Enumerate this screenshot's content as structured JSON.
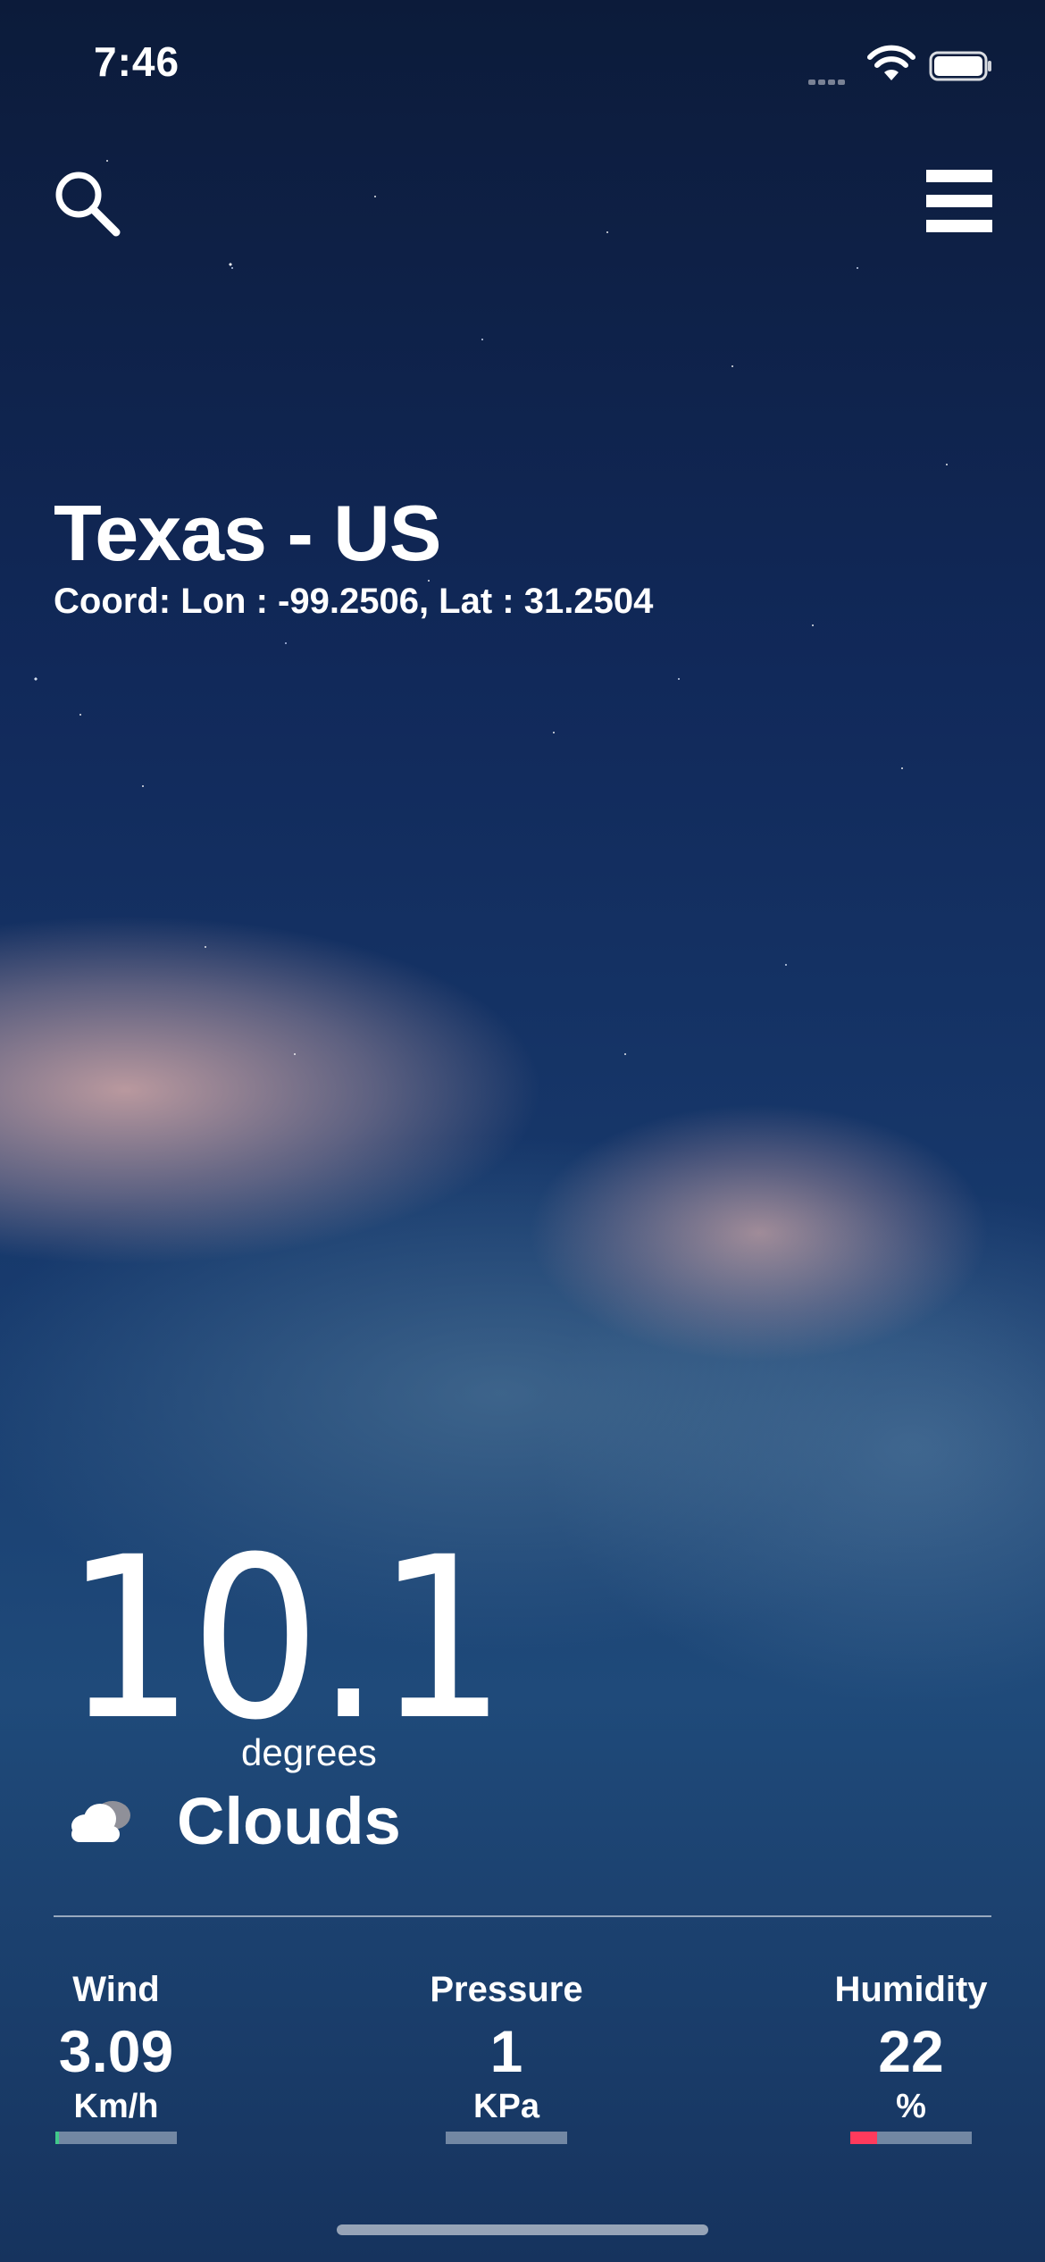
{
  "status_bar": {
    "time": "7:46",
    "signal_icon": "cellular-signal-icon",
    "wifi_icon": "wifi-icon",
    "battery_icon": "battery-icon"
  },
  "header": {
    "search_icon": "search-icon",
    "menu_icon": "hamburger-menu-icon"
  },
  "location": {
    "title": "Texas - US",
    "coordinates": "Coord: Lon : -99.2506, Lat : 31.2504"
  },
  "current": {
    "temperature": "10.1",
    "unit": "degrees",
    "condition": "Clouds",
    "condition_icon": "cloud-icon"
  },
  "stats": [
    {
      "label": "Wind",
      "value": "3.09",
      "unit": "Km/h",
      "level": 0.03,
      "bar_color": "#41c98a"
    },
    {
      "label": "Pressure",
      "value": "1",
      "unit": "KPa",
      "level": 0.0,
      "bar_color": "#7f8ea3"
    },
    {
      "label": "Humidity",
      "value": "22",
      "unit": "%",
      "level": 0.22,
      "bar_color": "#ff3a5c"
    }
  ],
  "colors": {
    "background": "#13315f",
    "text": "#ffffff",
    "bar_track": "#9aa6b6"
  }
}
